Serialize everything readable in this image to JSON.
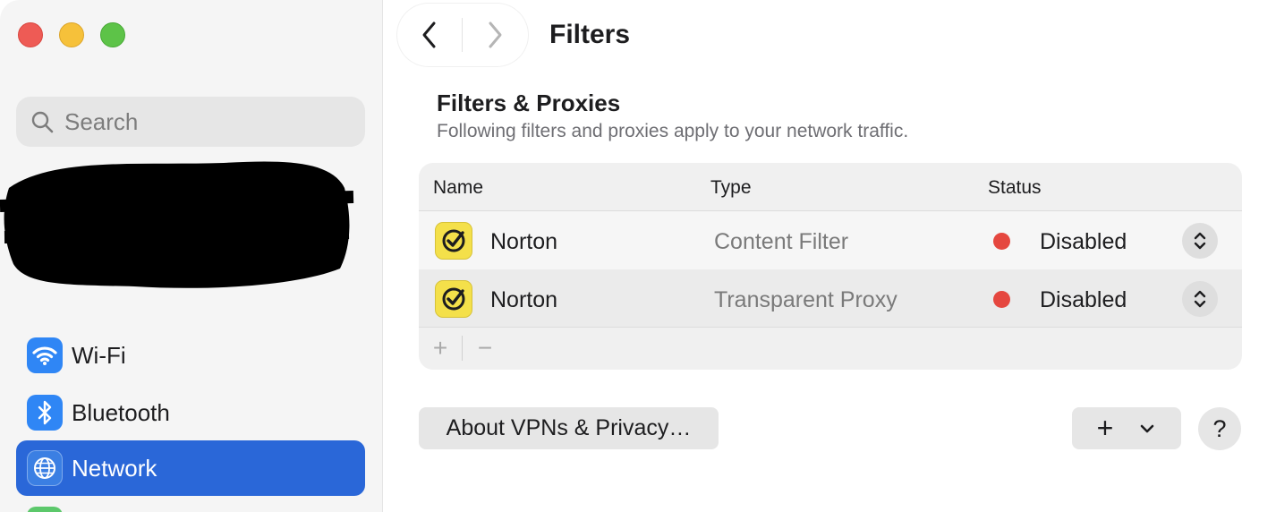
{
  "window": {
    "traffic_lights": [
      "close",
      "minimize",
      "zoom"
    ]
  },
  "sidebar": {
    "search": {
      "placeholder": "Search",
      "icon": "search-icon"
    },
    "items": [
      {
        "label": "Wi-Fi",
        "icon": "wifi-icon",
        "active": false
      },
      {
        "label": "Bluetooth",
        "icon": "bluetooth-icon",
        "active": false
      },
      {
        "label": "Network",
        "icon": "globe-icon",
        "active": true
      }
    ],
    "accent_color": "#2a67d8"
  },
  "header": {
    "title": "Filters",
    "back_icon": "chevron-left-icon",
    "forward_icon": "chevron-right-icon"
  },
  "section": {
    "title": "Filters & Proxies",
    "subtitle": "Following filters and proxies apply to your network traffic."
  },
  "table": {
    "columns": [
      "Name",
      "Type",
      "Status"
    ],
    "rows": [
      {
        "name": "Norton",
        "type": "Content Filter",
        "status": "Disabled",
        "status_color": "#e5473f",
        "icon": "norton-icon"
      },
      {
        "name": "Norton",
        "type": "Transparent Proxy",
        "status": "Disabled",
        "status_color": "#e5473f",
        "icon": "norton-icon"
      }
    ],
    "footer": {
      "add": "+",
      "remove": "−"
    }
  },
  "actions": {
    "about_label": "About VPNs & Privacy…",
    "add_label": "+",
    "help_label": "?"
  }
}
